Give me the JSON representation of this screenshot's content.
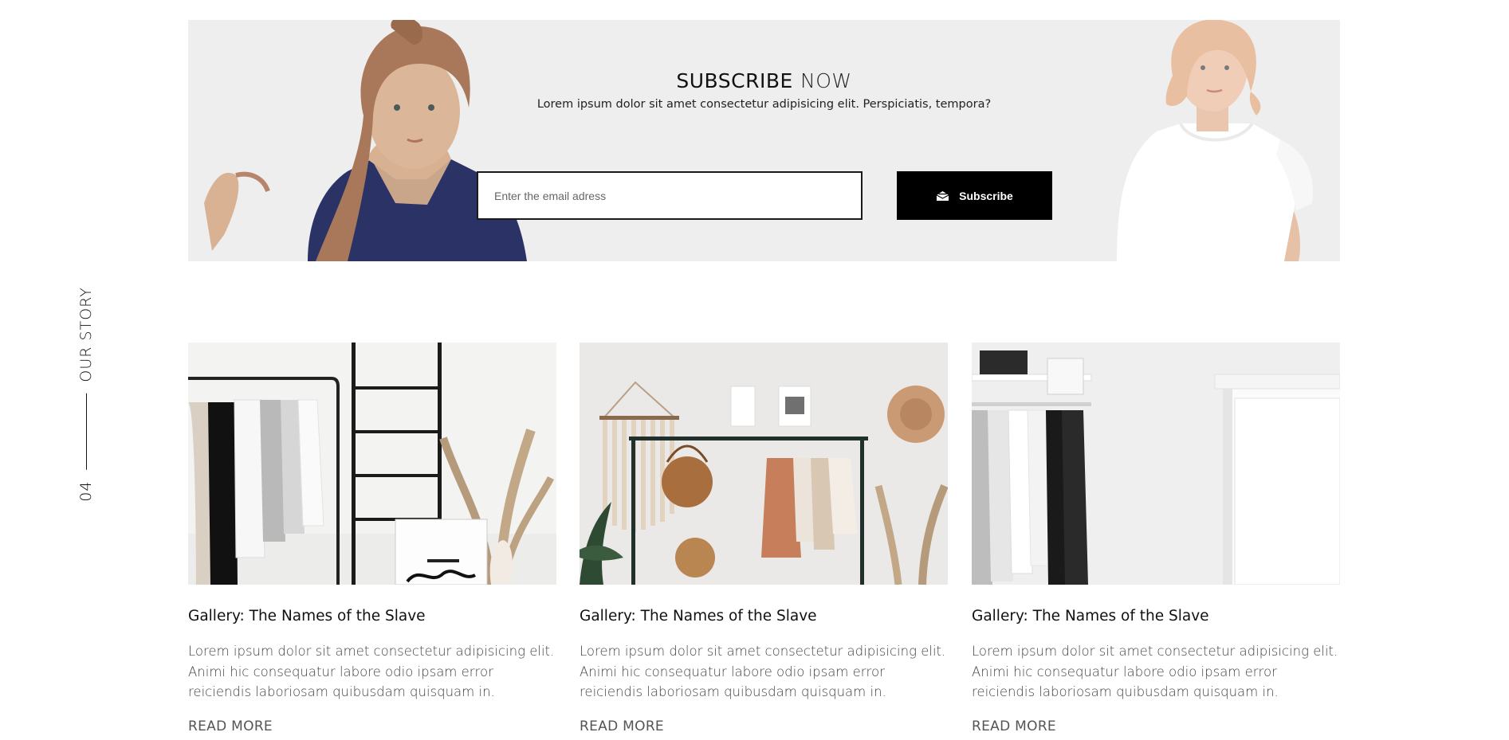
{
  "subscribe": {
    "title_strong": "SUBSCRIBE",
    "title_light": "NOW",
    "subtitle": "Lorem ipsum dolor sit amet consectetur adipisicing elit. Perspiciatis, tempora?",
    "email_placeholder": "Enter the email adress",
    "button_label": "Subscribe",
    "button_icon": "envelope-icon"
  },
  "side_label": {
    "number": "04",
    "text": "OUR STORY"
  },
  "posts": [
    {
      "title": "Gallery: The Names of the Slave",
      "excerpt": "Lorem ipsum dolor sit amet consectetur adipisicing elit. Animi hic consequatur labore odio ipsam error reiciendis laboriosam quibusdam quisquam in.",
      "link": "READ MORE"
    },
    {
      "title": "Gallery: The Names of the Slave",
      "excerpt": "Lorem ipsum dolor sit amet consectetur adipisicing elit. Animi hic consequatur labore odio ipsam error reiciendis laboriosam quibusdam quisquam in.",
      "link": "READ MORE"
    },
    {
      "title": "Gallery: The Names of the Slave",
      "excerpt": "Lorem ipsum dolor sit amet consectetur adipisicing elit. Animi hic consequatur labore odio ipsam error reiciendis laboriosam quibusdam quisquam in.",
      "link": "READ MORE"
    }
  ],
  "colors": {
    "banner_bg": "#efeeee",
    "button_bg": "#000000",
    "text_dark": "#111111"
  }
}
